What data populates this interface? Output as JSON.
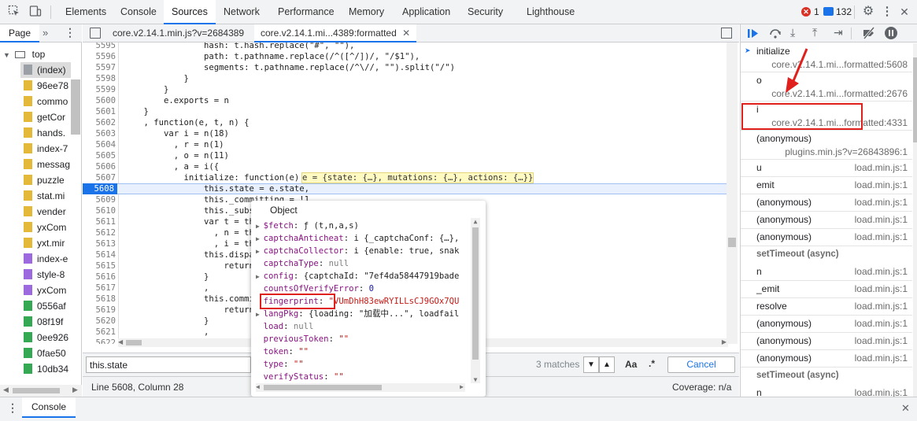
{
  "toolbar": {
    "tabs": [
      "Elements",
      "Console",
      "Sources",
      "Network",
      "Performance",
      "Memory",
      "Application",
      "Security",
      "Lighthouse"
    ],
    "active_tab": "Sources",
    "error_count": "1",
    "message_count": "132",
    "icons": [
      "inspect-icon",
      "device-icon",
      "error-icon",
      "message-icon",
      "gear-icon",
      "more-icon",
      "close-icon"
    ]
  },
  "navigator": {
    "tab_label": "Page",
    "root": "top",
    "files": [
      {
        "name": "(index)",
        "color": "#9aa0a6"
      },
      {
        "name": "96ee78",
        "color": "#e4b93a"
      },
      {
        "name": "commo",
        "color": "#e4b93a"
      },
      {
        "name": "getCor",
        "color": "#e4b93a"
      },
      {
        "name": "hands.",
        "color": "#e4b93a"
      },
      {
        "name": "index-7",
        "color": "#e4b93a"
      },
      {
        "name": "messag",
        "color": "#e4b93a"
      },
      {
        "name": "puzzle",
        "color": "#e4b93a"
      },
      {
        "name": "stat.mi",
        "color": "#e4b93a"
      },
      {
        "name": "vender",
        "color": "#e4b93a"
      },
      {
        "name": "yxCom",
        "color": "#e4b93a"
      },
      {
        "name": "yxt.mir",
        "color": "#e4b93a"
      },
      {
        "name": "index-e",
        "color": "#9c6ade"
      },
      {
        "name": "style-8",
        "color": "#9c6ade"
      },
      {
        "name": "yxCom",
        "color": "#9c6ade"
      },
      {
        "name": "0556af",
        "color": "#34a853"
      },
      {
        "name": "08f19f",
        "color": "#34a853"
      },
      {
        "name": "0ee926",
        "color": "#34a853"
      },
      {
        "name": "0fae50",
        "color": "#34a853"
      },
      {
        "name": "10db34",
        "color": "#34a853"
      }
    ]
  },
  "editor": {
    "tabs": [
      "core.v2.14.1.min.js?v=2684389",
      "core.v2.14.1.mi...4389:formatted"
    ],
    "active_tab_index": 1,
    "current_line": "5608",
    "inline_hint": "e = {state: {…}, mutations: {…}, actions: {…}}",
    "lines": [
      {
        "n": "5595",
        "t": "                hash: t.hash.replace(\"#\", \"\"),"
      },
      {
        "n": "5596",
        "t": "                path: t.pathname.replace(/^([^/])/, \"/$1\"),"
      },
      {
        "n": "5597",
        "t": "                segments: t.pathname.replace(/^\\//, \"\").split(\"/\")"
      },
      {
        "n": "5598",
        "t": "            }"
      },
      {
        "n": "5599",
        "t": "        }"
      },
      {
        "n": "5600",
        "t": "        e.exports = n"
      },
      {
        "n": "5601",
        "t": "    }"
      },
      {
        "n": "5602",
        "t": "    , function(e, t, n) {"
      },
      {
        "n": "5603",
        "t": "        var i = n(18)"
      },
      {
        "n": "5604",
        "t": "          , r = n(1)"
      },
      {
        "n": "5605",
        "t": "          , o = n(11)"
      },
      {
        "n": "5606",
        "t": "          , a = i({"
      },
      {
        "n": "5607",
        "t": "            initialize: function(e) {"
      },
      {
        "n": "5608",
        "t": "                this.state = e.state,"
      },
      {
        "n": "5609",
        "t": "                this._committing = !1"
      },
      {
        "n": "5610",
        "t": "                this._subscrib"
      },
      {
        "n": "5611",
        "t": "                var t = this"
      },
      {
        "n": "5612",
        "t": "                  , n = this.c"
      },
      {
        "n": "5613",
        "t": "                  , i = this.c"
      },
      {
        "n": "5614",
        "t": "                this.dispatch"
      },
      {
        "n": "5615",
        "t": "                    return n.c"
      },
      {
        "n": "5616",
        "t": "                }"
      },
      {
        "n": "5617",
        "t": "                ,"
      },
      {
        "n": "5618",
        "t": "                this.commit ="
      },
      {
        "n": "5619",
        "t": "                    return i.c"
      },
      {
        "n": "5620",
        "t": "                }"
      },
      {
        "n": "5621",
        "t": "                ,"
      },
      {
        "n": "5622",
        "t": "                "
      }
    ]
  },
  "search": {
    "query": "this.state",
    "matches": "3 matches",
    "case_label": "Aa",
    "regex_label": ".*",
    "cancel_label": "Cancel"
  },
  "status": {
    "position": "Line 5608, Column 28",
    "coverage": "Coverage: n/a"
  },
  "popover": {
    "title": "Object",
    "rows": [
      {
        "arrow": true,
        "key": "$fetch",
        "val": "ƒ (t,n,a,s)",
        "kind": "fn"
      },
      {
        "arrow": true,
        "key": "captchaAnticheat",
        "val": "i {_captchaConf: {…},",
        "kind": "obj"
      },
      {
        "arrow": true,
        "key": "captchaCollector",
        "val": "i {enable: true, snak",
        "kind": "obj"
      },
      {
        "arrow": false,
        "key": "captchaType",
        "val": "null",
        "kind": "nul"
      },
      {
        "arrow": true,
        "key": "config",
        "val": "{captchaId: \"7ef4da58447919bade",
        "kind": "obj"
      },
      {
        "arrow": false,
        "key": "countsOfVerifyError",
        "val": "0",
        "kind": "num"
      },
      {
        "arrow": false,
        "key": "fingerprint",
        "val": "\"VUmDhH83ewRYILLsCJ9GOx7QU",
        "kind": "str"
      },
      {
        "arrow": true,
        "key": "langPkg",
        "val": "{loading: \"加载中...\", loadfail",
        "kind": "obj"
      },
      {
        "arrow": false,
        "key": "load",
        "val": "null",
        "kind": "nul"
      },
      {
        "arrow": false,
        "key": "previousToken",
        "val": "\"\"",
        "kind": "str"
      },
      {
        "arrow": false,
        "key": "token",
        "val": "\"\"",
        "kind": "str"
      },
      {
        "arrow": false,
        "key": "type",
        "val": "\"\"",
        "kind": "str"
      },
      {
        "arrow": false,
        "key": "verifyStatus",
        "val": "\"\"",
        "kind": "str"
      }
    ]
  },
  "callstack": {
    "frames": [
      {
        "name": "initialize",
        "loc": "core.v2.14.1.mi...formatted:5608",
        "two_line": true,
        "current": true
      },
      {
        "name": "o",
        "loc": "core.v2.14.1.mi...formatted:2676",
        "two_line": true
      },
      {
        "name": "i",
        "loc": "core.v2.14.1.mi...formatted:4331",
        "two_line": true
      },
      {
        "name": "(anonymous)",
        "loc": "plugins.min.js?v=26843896:1",
        "two_line": true
      },
      {
        "name": "u",
        "loc": "load.min.js:1"
      },
      {
        "name": "emit",
        "loc": "load.min.js:1"
      },
      {
        "name": "(anonymous)",
        "loc": "load.min.js:1"
      },
      {
        "name": "(anonymous)",
        "loc": "load.min.js:1"
      },
      {
        "name": "(anonymous)",
        "loc": "load.min.js:1"
      },
      {
        "async": "setTimeout (async)"
      },
      {
        "name": "n",
        "loc": "load.min.js:1"
      },
      {
        "name": "_emit",
        "loc": "load.min.js:1"
      },
      {
        "name": "resolve",
        "loc": "load.min.js:1"
      },
      {
        "name": "(anonymous)",
        "loc": "load.min.js:1"
      },
      {
        "name": "(anonymous)",
        "loc": "load.min.js:1"
      },
      {
        "name": "(anonymous)",
        "loc": "load.min.js:1"
      },
      {
        "async": "setTimeout (async)"
      },
      {
        "name": "n",
        "loc": "load.min.js:1"
      }
    ]
  },
  "drawer": {
    "tab_label": "Console"
  },
  "colors": {
    "accent": "#1a73e8",
    "annotation_red": "#e0201d",
    "error_red": "#d93025"
  }
}
